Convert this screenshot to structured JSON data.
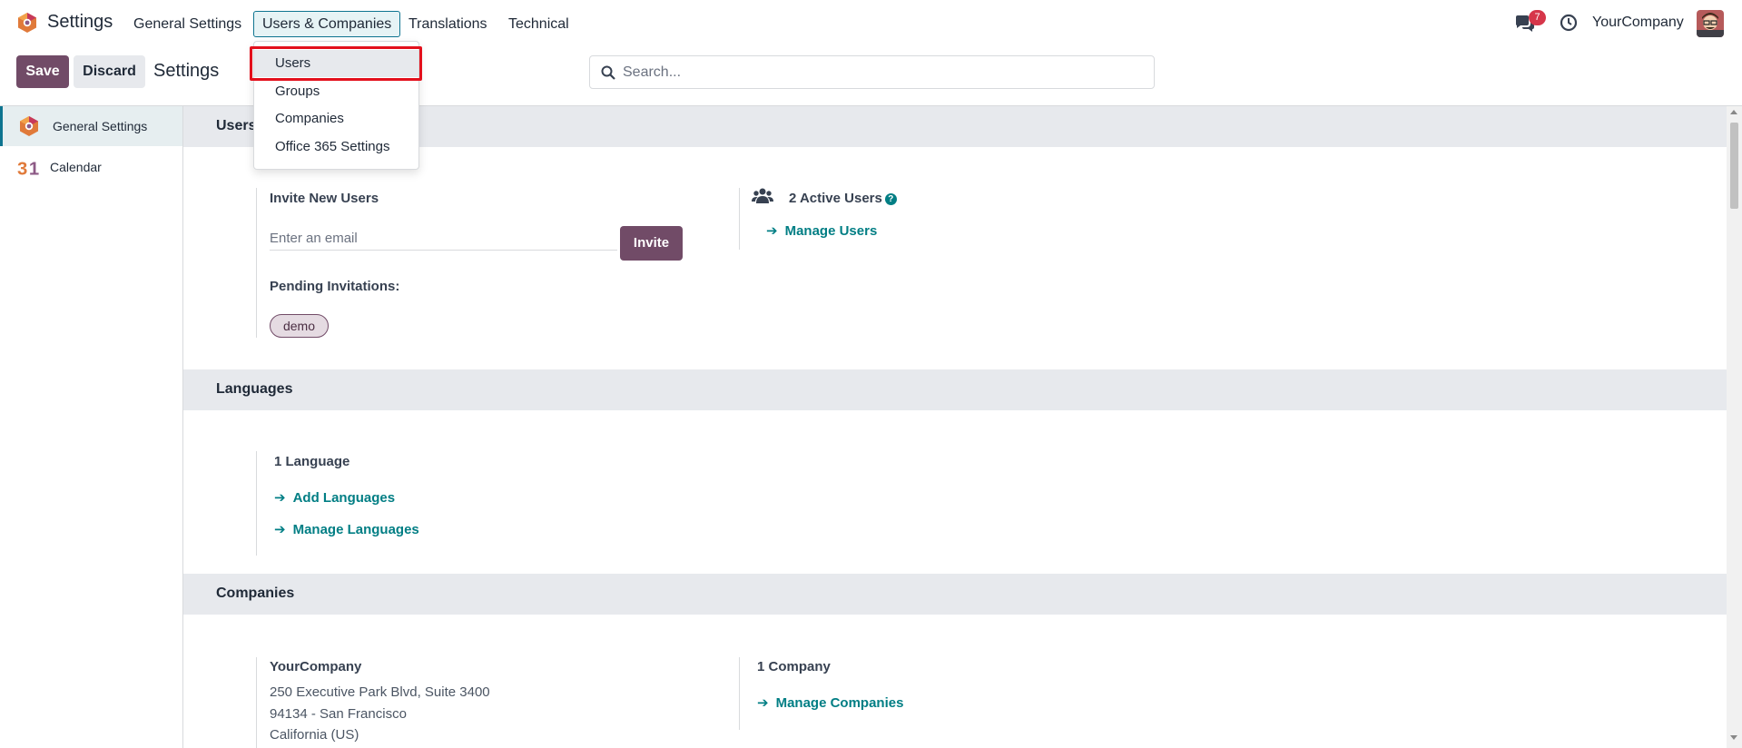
{
  "navbar": {
    "app_title": "Settings",
    "menus": [
      "General Settings",
      "Users & Companies",
      "Translations",
      "Technical"
    ],
    "active_menu": "Users & Companies",
    "chat_badge": "7",
    "company": "YourCompany"
  },
  "control_panel": {
    "save_label": "Save",
    "discard_label": "Discard",
    "breadcrumb": "Settings",
    "search_placeholder": "Search..."
  },
  "sidebar": {
    "items": [
      {
        "label": "General Settings",
        "icon": "odoo-settings-icon",
        "active": true
      },
      {
        "label": "Calendar",
        "icon": "calendar-31-icon",
        "active": false
      }
    ]
  },
  "dropdown": {
    "items": [
      "Users",
      "Groups",
      "Companies",
      "Office 365 Settings"
    ],
    "highlighted": "Users"
  },
  "users_section": {
    "title": "Users",
    "invite_label": "Invite New Users",
    "email_placeholder": "Enter an email",
    "invite_button": "Invite",
    "pending_label": "Pending Invitations:",
    "pending_tags": [
      "demo"
    ],
    "active_users": "2 Active Users",
    "manage_users": "Manage Users"
  },
  "languages_section": {
    "title": "Languages",
    "count": "1 Language",
    "add_link": "Add Languages",
    "manage_link": "Manage Languages"
  },
  "companies_section": {
    "title": "Companies",
    "company_name": "YourCompany",
    "address_line1": "250 Executive Park Blvd, Suite 3400",
    "address_line2": "94134 - San Francisco",
    "address_line3": "California (US)",
    "count": "1 Company",
    "manage_link": "Manage Companies"
  },
  "colors": {
    "brand": "#714b67",
    "link": "#017e84",
    "highlight_border": "#e3101c"
  }
}
